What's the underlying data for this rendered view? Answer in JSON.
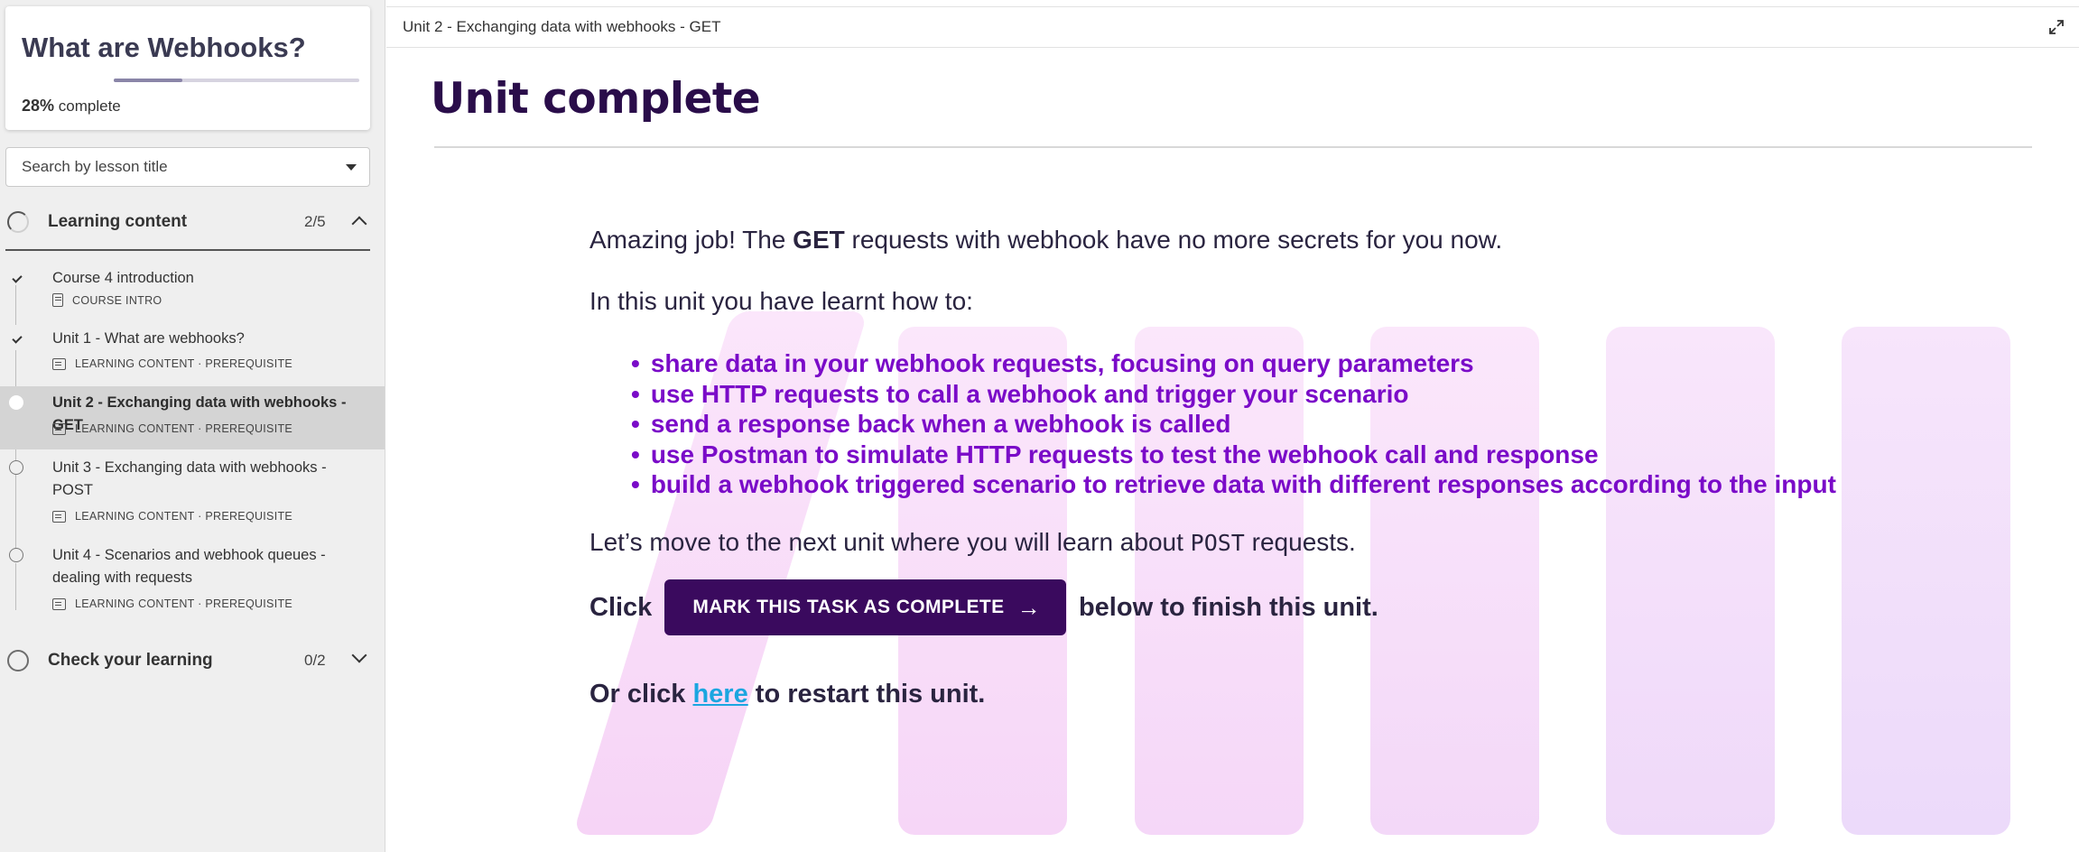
{
  "sidebar": {
    "course_title": "What are Webhooks?",
    "progress_percent": 28,
    "progress_percent_label": "28%",
    "progress_suffix": "complete",
    "search_placeholder": "Search by lesson title",
    "sections": [
      {
        "label": "Learning content",
        "count": "2/5",
        "expanded": true
      },
      {
        "label": "Check your learning",
        "count": "0/2",
        "expanded": false
      }
    ],
    "lessons": [
      {
        "title": "Course 4 introduction",
        "meta": "COURSE INTRO",
        "completed": true
      },
      {
        "title": "Unit 1 - What are webhooks?",
        "meta": "LEARNING CONTENT · PREREQUISITE",
        "completed": true
      },
      {
        "title": "Unit 2 - Exchanging data with webhooks - GET",
        "meta": "LEARNING CONTENT · PREREQUISITE",
        "completed": false,
        "active": true
      },
      {
        "title": "Unit 3 - Exchanging data with webhooks - POST",
        "meta": "LEARNING CONTENT · PREREQUISITE",
        "completed": false
      },
      {
        "title": "Unit 4 - Scenarios and webhook queues - dealing with requests",
        "meta": "LEARNING CONTENT · PREREQUISITE",
        "completed": false
      }
    ]
  },
  "header": {
    "breadcrumb": "Unit 2 - Exchanging data with webhooks - GET",
    "expand_icon": "expand-icon"
  },
  "main": {
    "title": "Unit complete",
    "intro_pre": "Amazing job! The ",
    "intro_bold": "GET",
    "intro_post": " requests with webhook have no more secrets for you now.",
    "learnt_heading": "In this unit you have learnt how to:",
    "bullets": [
      "share data in your webhook requests, focusing on query parameters",
      "use HTTP requests to call a webhook and trigger your scenario",
      "send a response back when a webhook is called",
      "use Postman to simulate HTTP requests to test the webhook call and response",
      "build a webhook triggered scenario to retrieve data with different responses according to the input"
    ],
    "next_pre": "Let’s move to the next unit where you will learn about ",
    "next_code": "POST",
    "next_post": " requests.",
    "click_pre": "Click",
    "complete_button": "MARK THIS TASK AS COMPLETE",
    "click_post": "below to finish this unit.",
    "restart_pre": "Or click ",
    "restart_link": "here",
    "restart_post": " to restart this unit."
  },
  "colors": {
    "accent_dark": "#3a0a5e",
    "bullet_purple": "#7a0bc8",
    "link_blue": "#1ba6e0"
  }
}
